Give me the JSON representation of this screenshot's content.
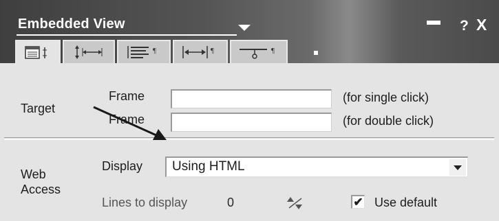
{
  "window": {
    "title": "Embedded View",
    "help_glyph": "?",
    "close_glyph": "X"
  },
  "tabs": [
    {
      "name": "basics-tab",
      "icon": "list-props-icon",
      "active": true
    },
    {
      "name": "size-tab",
      "icon": "resize-icon",
      "active": false
    },
    {
      "name": "alignment-tab",
      "icon": "paragraph-align-icon",
      "active": false
    },
    {
      "name": "spacing-tab",
      "icon": "width-arrows-icon",
      "active": false
    },
    {
      "name": "hide-tab",
      "icon": "hide-when-icon",
      "active": false
    }
  ],
  "target": {
    "section_label": "Target",
    "frame1_label": "Frame",
    "frame1_value": "",
    "frame1_note": "(for single click)",
    "frame2_label": "Frame",
    "frame2_value": "",
    "frame2_note": "(for double click)"
  },
  "web_access": {
    "section_label_line1": "Web",
    "section_label_line2": "Access",
    "display_label": "Display",
    "display_value": "Using HTML",
    "lines_label": "Lines to display",
    "lines_value": "0",
    "use_default_label": "Use default",
    "use_default_checked": true,
    "check_glyph": "✔"
  }
}
